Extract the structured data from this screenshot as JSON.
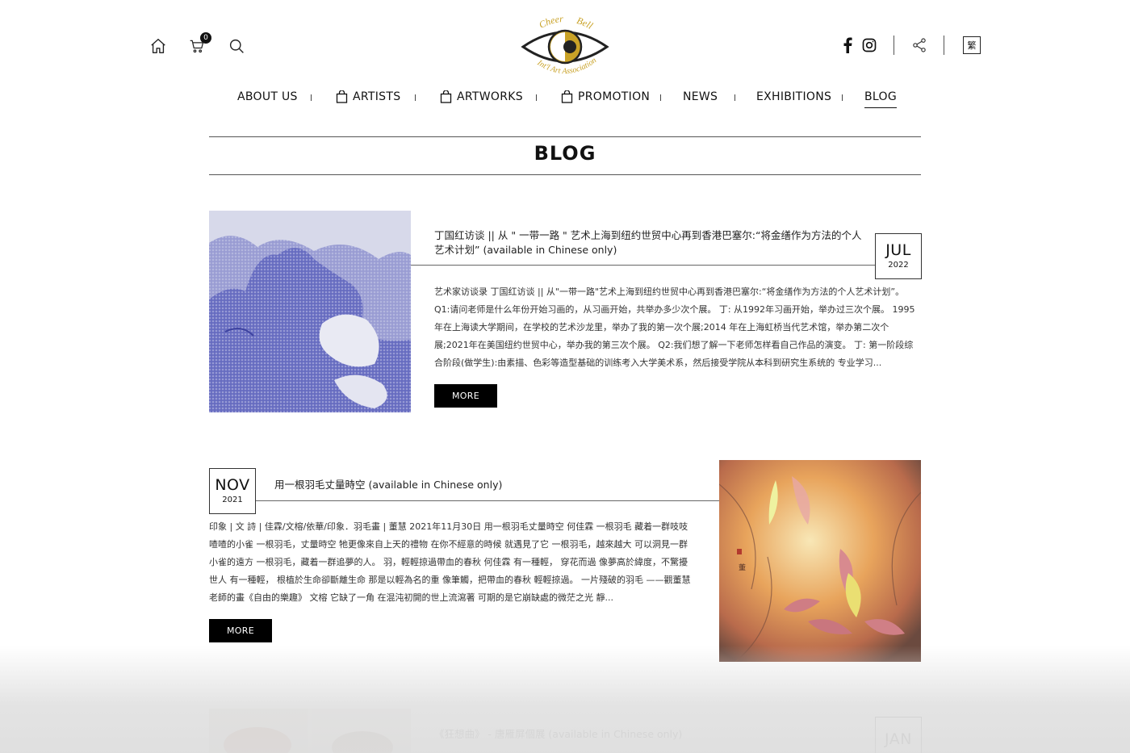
{
  "header": {
    "cart_count": "0",
    "logo_text_top_left": "Cheer",
    "logo_text_top_right": "Bell",
    "logo_text_bottom": "Int'l Art Association",
    "lang_label": "繁",
    "brand_gold": "#c9a227"
  },
  "nav": {
    "items": [
      {
        "label": "ABOUT US"
      },
      {
        "label": "ARTISTS"
      },
      {
        "label": "ARTWORKS"
      },
      {
        "label": "PROMOTION"
      },
      {
        "label": "NEWS"
      },
      {
        "label": "EXHIBITIONS"
      },
      {
        "label": "BLOG"
      }
    ],
    "active": "BLOG"
  },
  "page": {
    "title": "BLOG"
  },
  "posts": [
    {
      "title": "丁国红访谈 || 从 \" 一带一路 \" 艺术上海到纽约世贸中心再到香港巴塞尔:“将金缮作为方法的个人艺术计划” (available in Chinese only)",
      "month": "JUL",
      "year": "2022",
      "excerpt": "艺术家访谈录 丁国红访谈 || 从\"一带一路\"艺术上海到纽约世贸中心再到香港巴塞尔:“将金缮作为方法的个人艺术计划”。 Q1:请问老师是什么年份开始习画的，从习画开始，共举办多少次个展。 丁: 从1992年习画开始，举办过三次个展。 1995年在上海读大学期间，在学校的艺术沙龙里，举办了我的第一次个展;2014 年在上海虹桥当代艺术馆，举办第二次个展;2021年在美国纽约世贸中心，举办我的第三次个展。 Q2:我们想了解一下老师怎样看自己作品的演变。 丁: 第一阶段综合阶段(做学生):由素描、色彩等造型基础的训练考入大学美术系，然后接受学院从本科到研究生系统的 专业学习...",
      "more_label": "MORE"
    },
    {
      "title": "用一根羽毛丈量時空 (available in Chinese only)",
      "month": "NOV",
      "year": "2021",
      "excerpt": "印象 | 文 詩 | 佳霖/文榕/依華/印象．羽毛畫 | 董慧 2021年11月30日 用一根羽毛丈量時空 何佳霖 一根羽毛 藏着一群吱吱喳喳的小雀 一根羽毛，丈量時空 牠更像來自上天的禮物 在你不經意的時候 就遇見了它 一根羽毛，越來越大 可以洞見一群小雀的遠方 一根羽毛，藏着一群追夢的人。 羽，輕輕掠過帶血的春秋 何佳霖 有一種輕， 穿花而過 像夢高於緯度，不驚擾世人 有一種輕， 根植於生命卻斷離生命 那是以輕為名的重 像筆觸，把帶血的春秋 輕輕掠過。 一片殘破的羽毛 ——觀董慧老師的畫《自由的樂趣》 文榕 它缺了一角 在混沌初開的世上流瀉著 可期的是它崩缺處的微茫之光 靜...",
      "more_label": "MORE"
    },
    {
      "title": "《狂想曲》 - 唐雁屏個展 (available in Chinese only)",
      "month": "JAN",
      "year": ""
    }
  ]
}
